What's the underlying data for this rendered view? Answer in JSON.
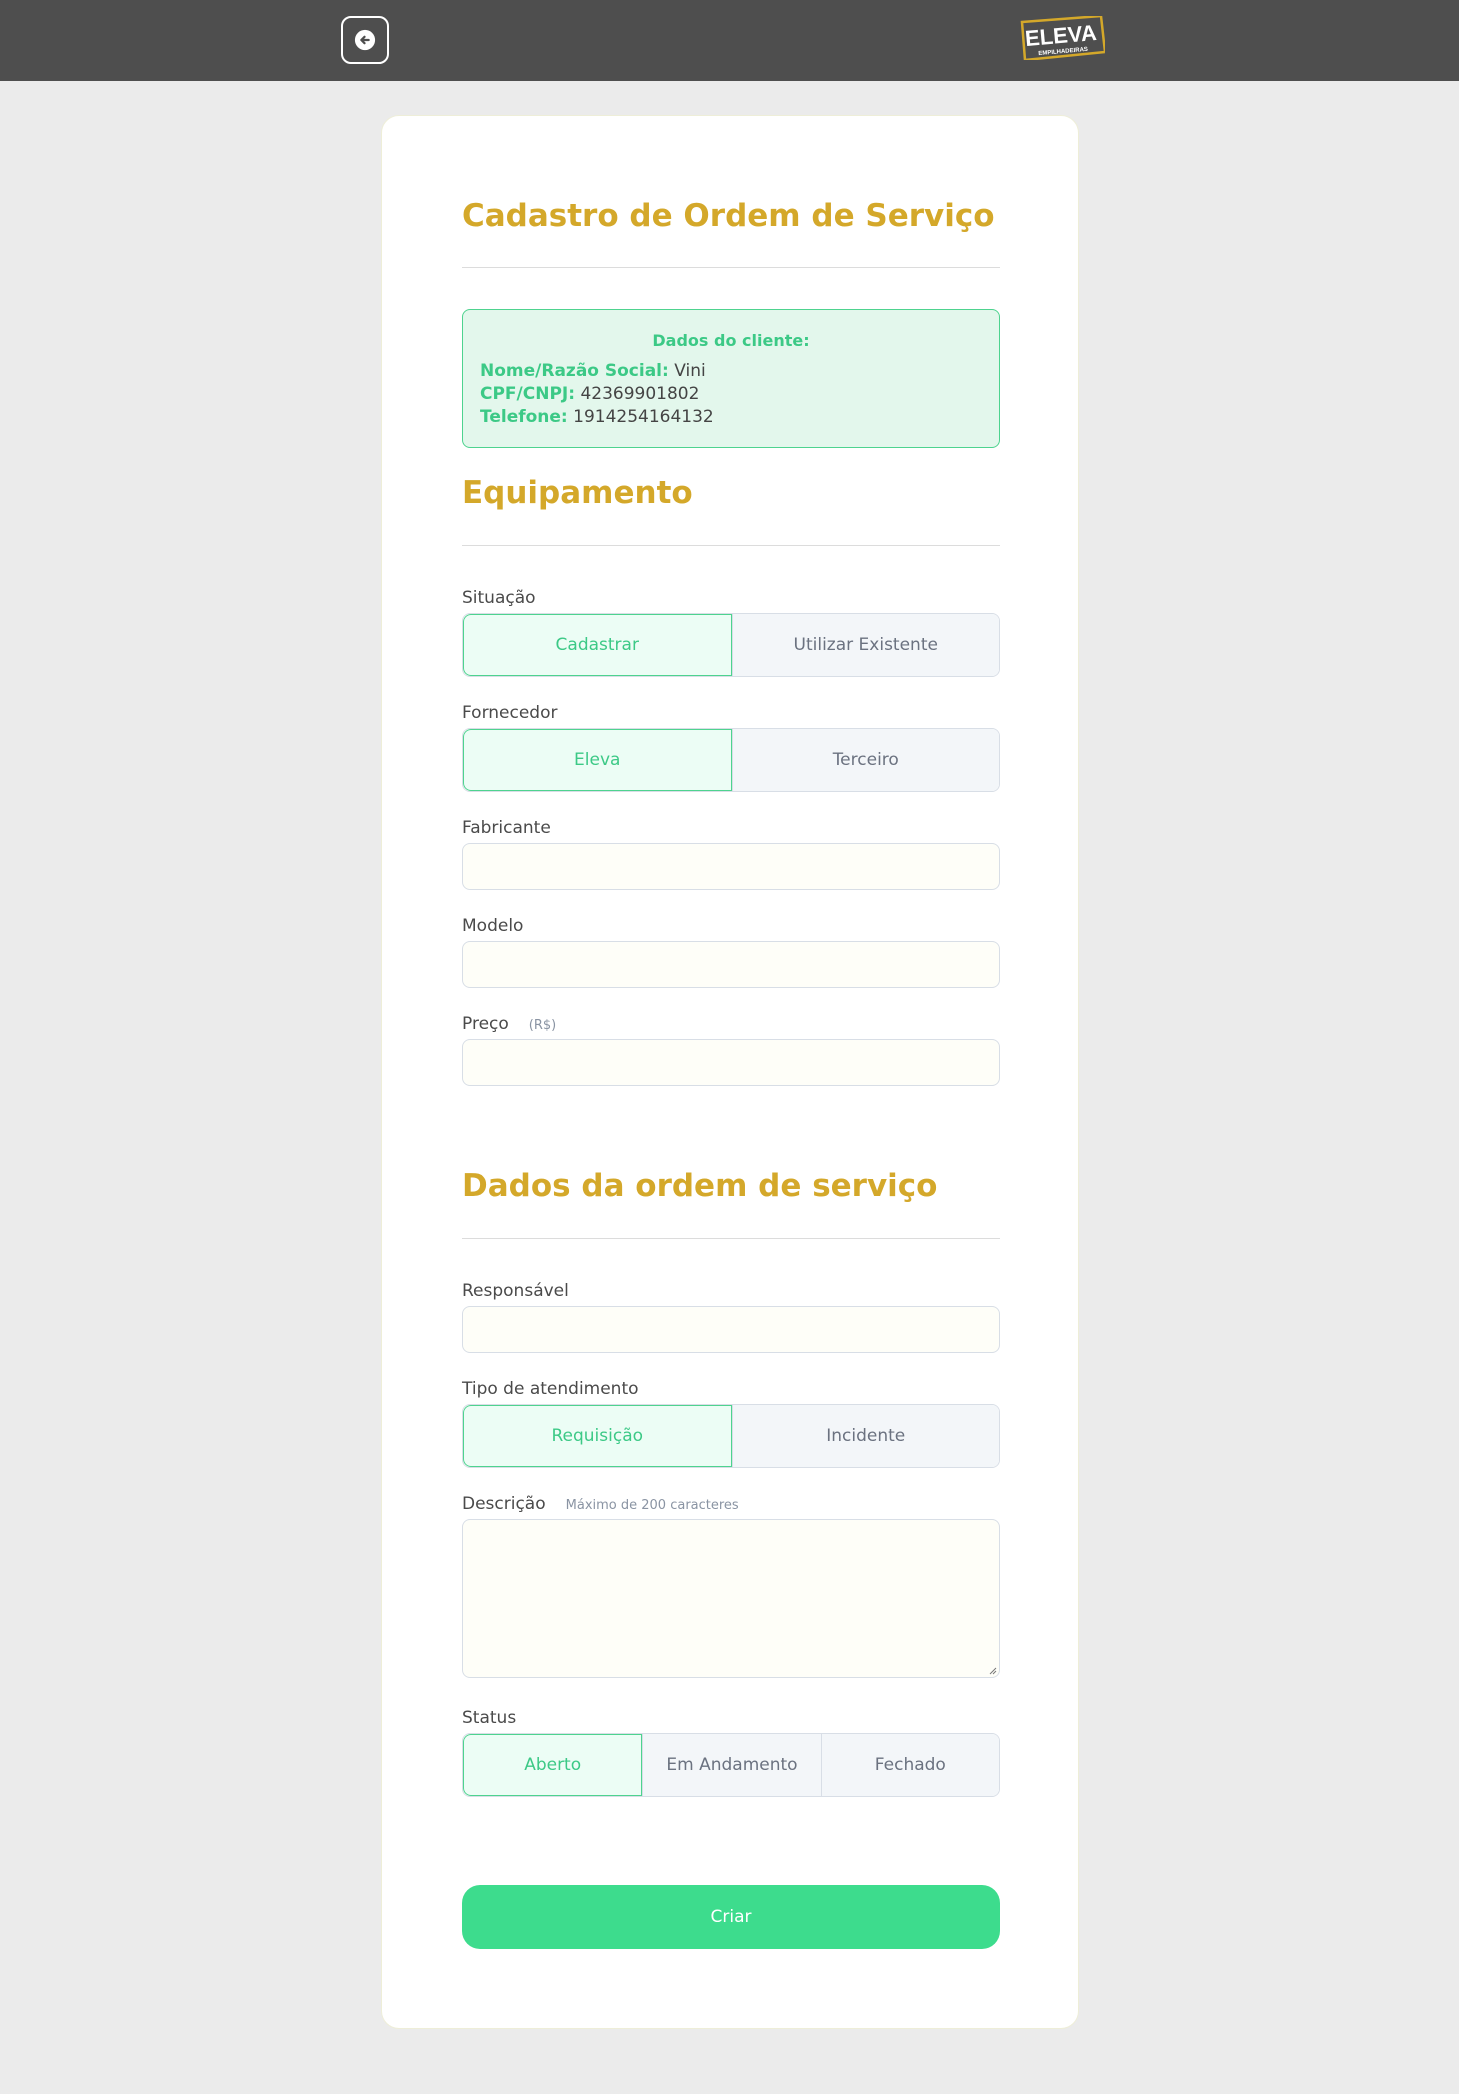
{
  "header": {
    "back_icon": "arrow-left-icon",
    "logo": {
      "text": "ELEVA",
      "subtext": "EMPILHADEIRAS",
      "brand_color": "#d4a82a"
    }
  },
  "form": {
    "title": "Cadastro de Ordem de Serviço",
    "client": {
      "heading": "Dados do cliente:",
      "name_label": "Nome/Razão Social:",
      "name_value": "Vini",
      "doc_label": "CPF/CNPJ:",
      "doc_value": "42369901802",
      "phone_label": "Telefone:",
      "phone_value": "1914254164132"
    },
    "equipment": {
      "title": "Equipamento",
      "situation": {
        "label": "Situação",
        "options": [
          "Cadastrar",
          "Utilizar Existente"
        ],
        "selected": "Cadastrar"
      },
      "supplier": {
        "label": "Fornecedor",
        "options": [
          "Eleva",
          "Terceiro"
        ],
        "selected": "Eleva"
      },
      "manufacturer": {
        "label": "Fabricante",
        "value": ""
      },
      "model": {
        "label": "Modelo",
        "value": ""
      },
      "price": {
        "label": "Preço",
        "unit": "(R$)",
        "value": ""
      }
    },
    "order": {
      "title": "Dados da ordem de serviço",
      "responsible": {
        "label": "Responsável",
        "value": ""
      },
      "service_type": {
        "label": "Tipo de atendimento",
        "options": [
          "Requisição",
          "Incidente"
        ],
        "selected": "Requisição"
      },
      "description": {
        "label": "Descrição",
        "hint": "Máximo de 200 caracteres",
        "value": ""
      },
      "status": {
        "label": "Status",
        "options": [
          "Aberto",
          "Em Andamento",
          "Fechado"
        ],
        "selected": "Aberto"
      }
    },
    "submit_label": "Criar"
  },
  "colors": {
    "accent_gold": "#d4a82a",
    "accent_green": "#3ddc8d",
    "topbar": "#4e4e4e",
    "background": "#ebebeb"
  }
}
